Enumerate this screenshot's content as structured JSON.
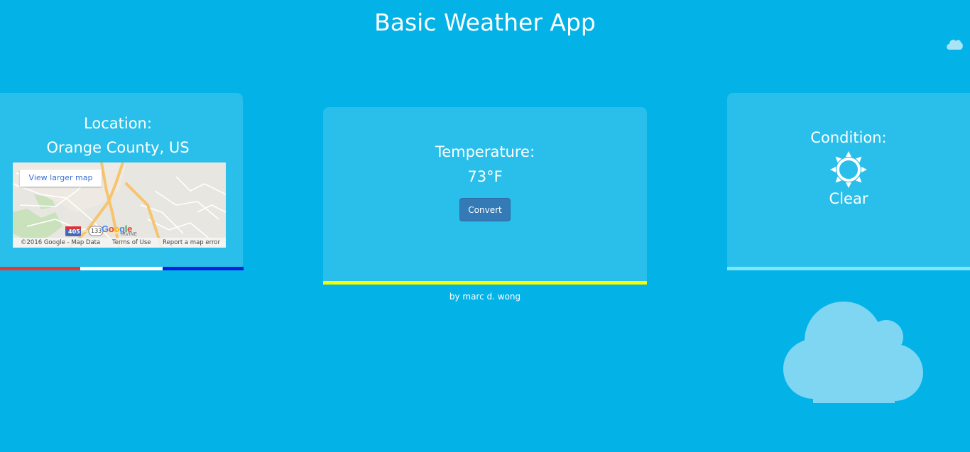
{
  "app": {
    "title": "Basic Weather App"
  },
  "location": {
    "heading": "Location:",
    "value": "Orange County, US",
    "map": {
      "view_larger_label": "View larger map",
      "logo_text": "Google",
      "footer": {
        "copyright": "©2016 Google - Map Data",
        "terms": "Terms of Use",
        "report": "Report a map error"
      },
      "road_shields": [
        "405",
        "133"
      ],
      "place_label": "IRVINE"
    },
    "flag_colors": [
      "#ee3333",
      "#ffffff",
      "#0022dd"
    ]
  },
  "temperature": {
    "heading": "Temperature:",
    "value": "73°F",
    "convert_label": "Convert",
    "accent_color": "#f5ff00"
  },
  "condition": {
    "heading": "Condition:",
    "value": "Clear",
    "icon": "sun-icon",
    "accent_color": "#7fe6f7"
  },
  "footer": {
    "byline": "by marc d. wong"
  },
  "colors": {
    "background": "#03b3e8",
    "card": "#29bfea",
    "button": "#337ab7",
    "cloud": "#7fd6f3"
  }
}
